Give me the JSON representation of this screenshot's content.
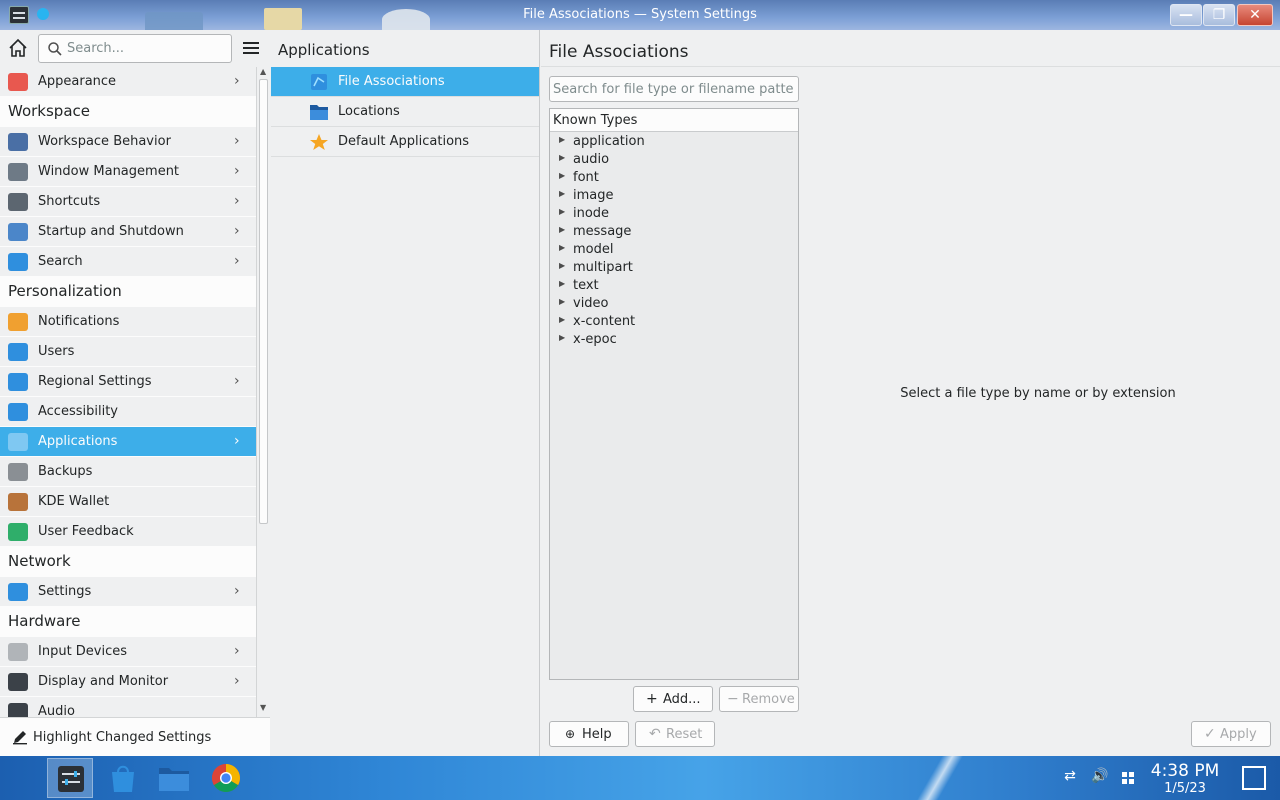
{
  "window": {
    "title": "File Associations — System Settings",
    "controls": {
      "minimize": "—",
      "maximize": "❐",
      "close": "✕"
    }
  },
  "sidebar": {
    "search_placeholder": "Search...",
    "rows": [
      {
        "type": "item",
        "label": "Appearance",
        "icon": "appearance-icon",
        "color": "#e8584f",
        "chevron": true
      },
      {
        "type": "section",
        "label": "Workspace"
      },
      {
        "type": "item",
        "label": "Workspace Behavior",
        "icon": "workspace-behavior-icon",
        "color": "#4a6fa5",
        "chevron": true
      },
      {
        "type": "item",
        "label": "Window Management",
        "icon": "window-management-icon",
        "color": "#6e7a86",
        "chevron": true
      },
      {
        "type": "item",
        "label": "Shortcuts",
        "icon": "keyboard-icon",
        "color": "#5c6670",
        "chevron": true
      },
      {
        "type": "item",
        "label": "Startup and Shutdown",
        "icon": "startup-icon",
        "color": "#4b86c9",
        "chevron": true
      },
      {
        "type": "item",
        "label": "Search",
        "icon": "search-icon",
        "color": "#2f8fde",
        "chevron": true
      },
      {
        "type": "section",
        "label": "Personalization"
      },
      {
        "type": "item",
        "label": "Notifications",
        "icon": "bell-icon",
        "color": "#f0a030",
        "chevron": false
      },
      {
        "type": "item",
        "label": "Users",
        "icon": "users-icon",
        "color": "#2f8fde",
        "chevron": false
      },
      {
        "type": "item",
        "label": "Regional Settings",
        "icon": "regional-icon",
        "color": "#2f8fde",
        "chevron": true
      },
      {
        "type": "item",
        "label": "Accessibility",
        "icon": "accessibility-icon",
        "color": "#2f8fde",
        "chevron": false
      },
      {
        "type": "item",
        "label": "Applications",
        "icon": "applications-icon",
        "color": "#7fc8f2",
        "chevron": true,
        "selected": true
      },
      {
        "type": "item",
        "label": "Backups",
        "icon": "backups-icon",
        "color": "#8a8f94",
        "chevron": false
      },
      {
        "type": "item",
        "label": "KDE Wallet",
        "icon": "wallet-icon",
        "color": "#b8733a",
        "chevron": false
      },
      {
        "type": "item",
        "label": "User Feedback",
        "icon": "feedback-icon",
        "color": "#2fae6a",
        "chevron": false
      },
      {
        "type": "section",
        "label": "Network"
      },
      {
        "type": "item",
        "label": "Settings",
        "icon": "globe-icon",
        "color": "#2f8fde",
        "chevron": true
      },
      {
        "type": "section",
        "label": "Hardware"
      },
      {
        "type": "item",
        "label": "Input Devices",
        "icon": "mouse-icon",
        "color": "#b0b4b8",
        "chevron": true
      },
      {
        "type": "item",
        "label": "Display and Monitor",
        "icon": "monitor-icon",
        "color": "#3b4148",
        "chevron": true
      },
      {
        "type": "item",
        "label": "Audio",
        "icon": "audio-icon",
        "color": "#3b4148",
        "chevron": false
      }
    ],
    "highlight_label": "Highlight Changed Settings"
  },
  "midcol": {
    "heading": "Applications",
    "items": [
      {
        "label": "File Associations",
        "icon": "file-associations-icon",
        "selected": true
      },
      {
        "label": "Locations",
        "icon": "folder-icon",
        "selected": false
      },
      {
        "label": "Default Applications",
        "icon": "star-icon",
        "selected": false
      }
    ]
  },
  "content": {
    "heading": "File Associations",
    "search_placeholder": "Search for file type or filename patter...",
    "tree_header": "Known Types",
    "types": [
      "application",
      "audio",
      "font",
      "image",
      "inode",
      "message",
      "model",
      "multipart",
      "text",
      "video",
      "x-content",
      "x-epoc"
    ],
    "hint": "Select a file type by name or by extension",
    "buttons": {
      "add": "Add...",
      "remove": "Remove",
      "help": "Help",
      "reset": "Reset",
      "apply": "Apply"
    }
  },
  "taskbar": {
    "time": "4:38 PM",
    "date": "1/5/23"
  },
  "colors": {
    "accent": "#3daee9",
    "window_bg": "#eff0f1",
    "view_bg": "#fcfcfc"
  }
}
